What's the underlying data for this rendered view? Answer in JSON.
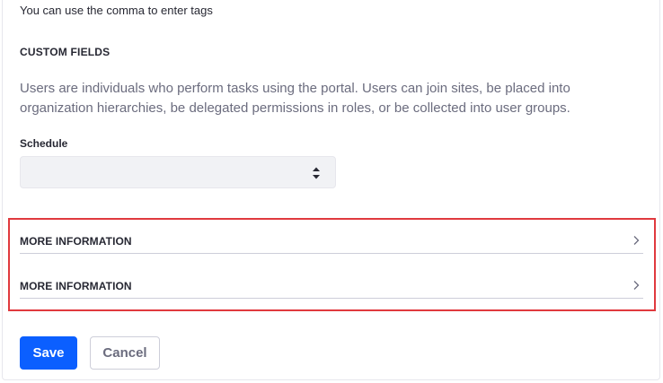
{
  "tags_hint": "You can use the comma to enter tags",
  "custom_fields": {
    "title": "CUSTOM FIELDS",
    "description": "Users are individuals who perform tasks using the portal.  Users can join sites, be placed into organization hierarchies, be delegated permissions in roles, or be collected into user groups.",
    "schedule_label": "Schedule",
    "schedule_value": ""
  },
  "panels": [
    {
      "label": "MORE INFORMATION",
      "icon": "chevron-right-icon"
    },
    {
      "label": "MORE INFORMATION",
      "icon": "chevron-right-icon"
    }
  ],
  "actions": {
    "save_label": "Save",
    "cancel_label": "Cancel"
  },
  "colors": {
    "primary": "#0b5fff",
    "highlight_border": "#e0393e",
    "muted_text": "#6b6c7e"
  }
}
